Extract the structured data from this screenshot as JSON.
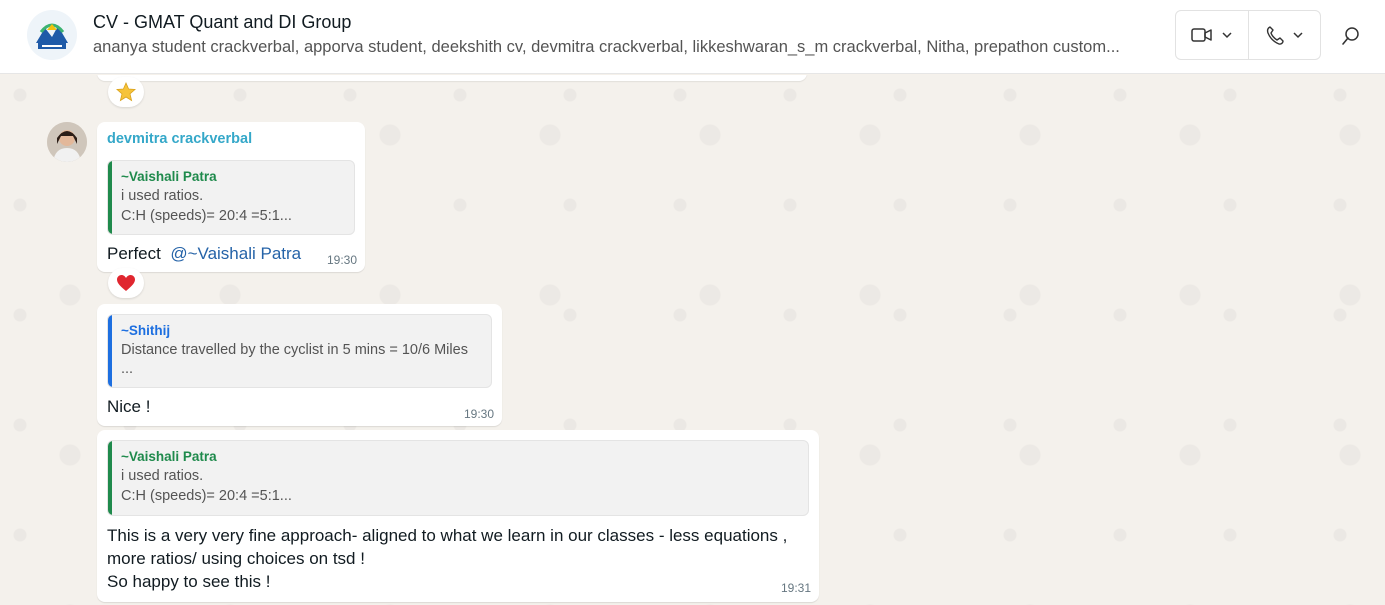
{
  "header": {
    "title": "CV - GMAT Quant and DI Group",
    "members": "ananya student crackverbal, apporva student, deekshith cv, devmitra crackverbal, likkeshwaran_s_m crackverbal, Nitha, prepathon custom...",
    "icons": [
      "group-avatar",
      "video-call-icon",
      "voice-call-icon",
      "chevron-down-icon",
      "search-icon"
    ]
  },
  "messages": [
    {
      "sender": "devmitra crackverbal",
      "quote": {
        "author": "~Vaishali Patra",
        "lines": [
          "i used ratios.",
          "C:H (speeds)=  20:4 =5:1..."
        ],
        "color": "#1f8a4c"
      },
      "text_prefix": "Perfect",
      "mention": "@~Vaishali Patra",
      "time": "19:30",
      "reaction": "heart"
    },
    {
      "quote": {
        "author": "~Shithij",
        "lines": [
          "Distance travelled by the cyclist in 5 mins = 10/6 Miles",
          "..."
        ],
        "color": "#1d6fe0"
      },
      "text": "Nice !",
      "time": "19:30"
    },
    {
      "quote": {
        "author": "~Vaishali Patra",
        "lines": [
          "i used ratios.",
          "C:H (speeds)=  20:4 =5:1..."
        ],
        "color": "#1f8a4c"
      },
      "text_lines": [
        "This is a very very fine approach- aligned to what we learn in our classes - less equations ,",
        "more ratios/ using choices on tsd !",
        "So happy to see this !"
      ],
      "time": "19:31"
    }
  ],
  "top_reaction": "star"
}
